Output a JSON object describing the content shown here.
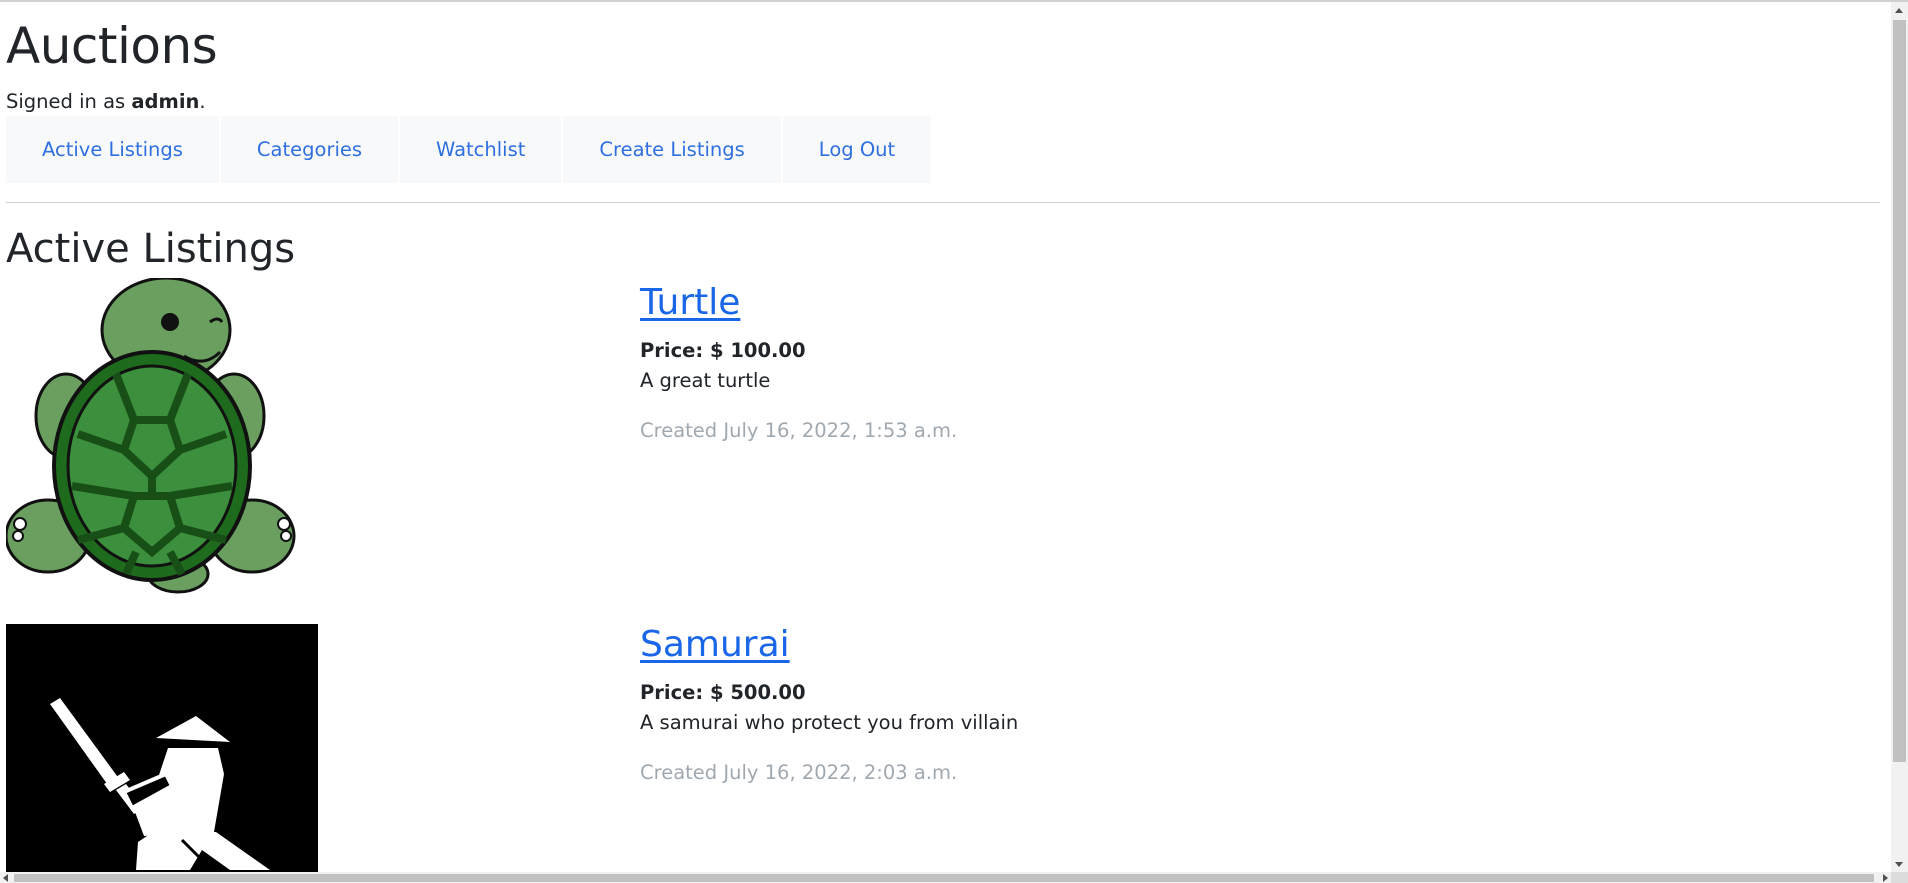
{
  "header": {
    "title": "Auctions",
    "signed_in_prefix": "Signed in as ",
    "username": "admin",
    "signed_in_suffix": "."
  },
  "nav": [
    {
      "label": "Active Listings"
    },
    {
      "label": "Categories"
    },
    {
      "label": "Watchlist"
    },
    {
      "label": "Create Listings"
    },
    {
      "label": "Log Out"
    }
  ],
  "main": {
    "heading": "Active Listings",
    "listings": [
      {
        "title": "Turtle",
        "price": "Price: $ 100.00",
        "description": "A great turtle",
        "created": "Created July 16, 2022, 1:53 a.m.",
        "image_icon": "turtle-image"
      },
      {
        "title": "Samurai",
        "price": "Price: $ 500.00",
        "description": "A samurai who protect you from villain",
        "created": "Created July 16, 2022, 2:03 a.m.",
        "image_icon": "samurai-image"
      }
    ]
  },
  "colors": {
    "link": "#1a66e8",
    "nav_bg": "#f8f9fa",
    "muted": "#a0a8b0",
    "turtle_shell": "#1e6b1e",
    "turtle_skin": "#6a9f60"
  }
}
